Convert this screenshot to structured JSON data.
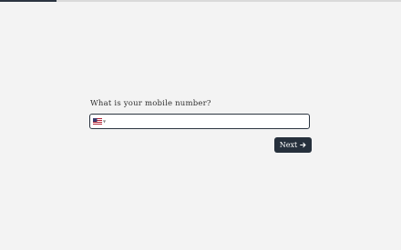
{
  "progress": {
    "fraction": 0.14
  },
  "question": {
    "text": "What is your mobile number?"
  },
  "phone": {
    "country_flag_icon": "us-flag-icon",
    "value": "",
    "placeholder": ""
  },
  "next_button": {
    "label": "Next",
    "icon": "arrow-right-icon"
  },
  "colors": {
    "background": "#f3f3f3",
    "accent": "#26303c",
    "track": "#d9d9d9"
  }
}
